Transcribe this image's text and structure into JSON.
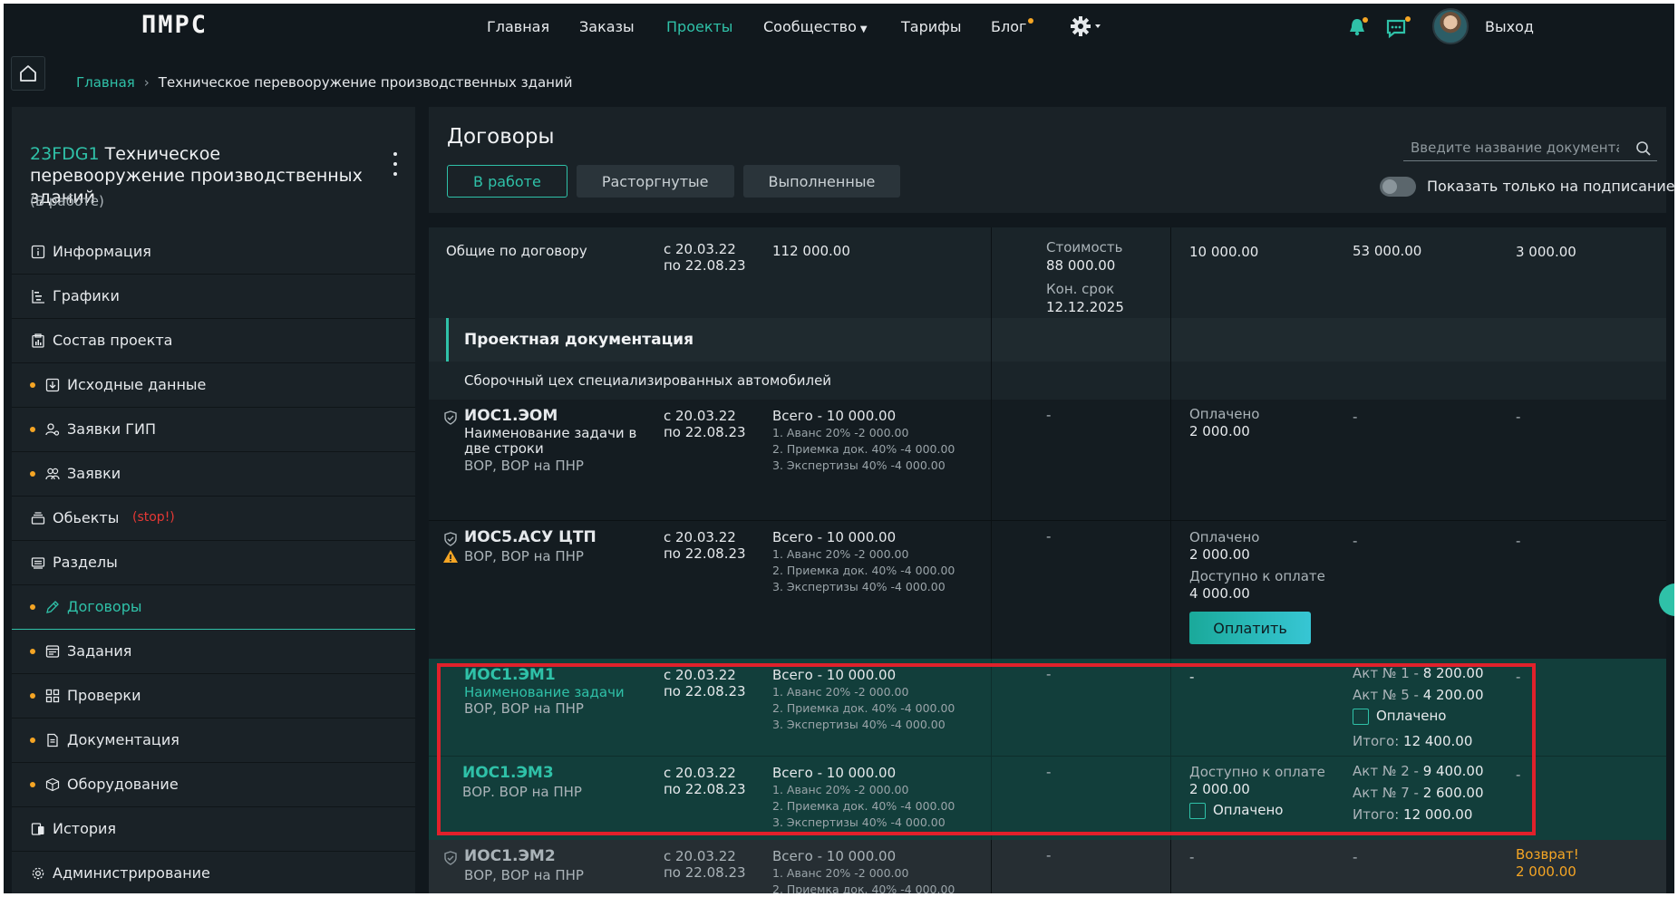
{
  "nav": {
    "logo": "ПМРС",
    "items": [
      "Главная",
      "Заказы",
      "Проекты",
      "Сообщество",
      "Тарифы",
      "Блог"
    ],
    "logout": "Выход"
  },
  "breadcrumb": {
    "home": "Главная",
    "current": "Техническое перевооружение производственных зданий"
  },
  "project": {
    "code": "23FDG1",
    "name": "Техническое перевооружение производственных зданий",
    "status": "(В работе)"
  },
  "sidebar": {
    "items": [
      {
        "label": "Информация",
        "icon": "info-icon",
        "dot": false
      },
      {
        "label": "Графики",
        "icon": "gantt-icon",
        "dot": false
      },
      {
        "label": "Состав проекта",
        "icon": "clipboard-chart-icon",
        "dot": false
      },
      {
        "label": "Исходные данные",
        "icon": "download-box-icon",
        "dot": true
      },
      {
        "label": "Заявки ГИП",
        "icon": "user-gear-icon",
        "dot": true
      },
      {
        "label": "Заявки",
        "icon": "users-icon",
        "dot": true
      },
      {
        "label": "Обьекты",
        "icon": "layers-icon",
        "dot": false,
        "badge": "(stop!)"
      },
      {
        "label": "Разделы",
        "icon": "sections-icon",
        "dot": false
      },
      {
        "label": "Договоры",
        "icon": "pen-icon",
        "dot": true,
        "active": true
      },
      {
        "label": "Задания",
        "icon": "tasks-icon",
        "dot": true
      },
      {
        "label": "Проверки",
        "icon": "grid-icon",
        "dot": true
      },
      {
        "label": "Документация",
        "icon": "document-icon",
        "dot": true
      },
      {
        "label": "Оборудование",
        "icon": "box-icon",
        "dot": true
      },
      {
        "label": "История",
        "icon": "history-icon",
        "dot": false
      },
      {
        "label": "Администрирование",
        "icon": "gear-icon",
        "dot": false
      }
    ]
  },
  "main": {
    "title": "Договоры",
    "tabs": [
      "В работе",
      "Расторгнутые",
      "Выполненные"
    ],
    "search_placeholder": "Введите название документа",
    "toggle_label": "Показать только на подписание"
  },
  "table": {
    "summary": {
      "label": "Общие по договору",
      "date_from": "с 20.03.22",
      "date_to": "по 22.08.23",
      "total": "112 000.00",
      "cost_label": "Стоимость",
      "cost": "88 000.00",
      "deadline_label": "Кон. срок",
      "deadline": "12.12.2025",
      "c5": "10 000.00",
      "c6": "53 000.00",
      "c7": "3 000.00"
    },
    "section": "Проектная документация",
    "subsection": "Сборочный цех специализированных автомобилей",
    "rows": [
      {
        "code": "ИОС1.ЭОМ",
        "name1": "Наименование задачи в",
        "name2": "две строки",
        "vor": "ВОР, ВОР на ПНР",
        "from": "с 20.03.22",
        "to": "по 22.08.23",
        "total": "Всего - 10 000.00",
        "s1": "1. Аванс 20% -2 000.00",
        "s2": "2. Приемка док. 40% -4 000.00",
        "s3": "3. Экспертизы 40% -4 000.00",
        "c4": "-",
        "paid_label": "Оплачено",
        "paid": "2 000.00",
        "c6": "-",
        "c7": "-"
      },
      {
        "code": "ИОС5.АСУ ЦТП",
        "vor": "ВОР, ВОР на ПНР",
        "from": "с 20.03.22",
        "to": "по 22.08.23",
        "total": "Всего - 10 000.00",
        "s1": "1. Аванс 20% -2 000.00",
        "s2": "2. Приемка док. 40% -4 000.00",
        "s3": "3. Экспертизы 40% -4 000.00",
        "c4": "-",
        "paid_label": "Оплачено",
        "paid": "2 000.00",
        "avail_label": "Доступно к оплате",
        "avail": "4 000.00",
        "pay_button": "Оплатить",
        "c6": "-",
        "c7": "-"
      },
      {
        "code": "ИОС1.ЭМ1",
        "name1": "Наименование задачи",
        "vor": "ВОР, ВОР на ПНР",
        "from": "с 20.03.22",
        "to": "по 22.08.23",
        "total": "Всего - 10 000.00",
        "s1": "1. Аванс 20% -2 000.00",
        "s2": "2. Приемка док. 40% -4 000.00",
        "s3": "3. Экспертизы 40% -4 000.00",
        "c4": "-",
        "c5": "-",
        "act1_label": "Акт № 1 -",
        "act1": "8 200.00",
        "act2_label": "Акт № 5 -",
        "act2": "4 200.00",
        "paid_check": "Оплачено",
        "sum_label": "Итого:",
        "sum": "12 400.00",
        "c7": "-"
      },
      {
        "code": "ИОС1.ЭМ3",
        "vor": "ВОР. ВОР на ПНР",
        "from": "с 20.03.22",
        "to": "по 22.08.23",
        "total": "Всего - 10 000.00",
        "s1": "1. Аванс 20% -2 000.00",
        "s2": "2. Приемка док. 40% -4 000.00",
        "s3": "3. Экспертизы 40% -4 000.00",
        "c4": "-",
        "avail_label": "Доступно к оплате",
        "avail": "2 000.00",
        "paid_check": "Оплачено",
        "act1_label": "Акт № 2 -",
        "act1": "9 400.00",
        "act2_label": "Акт № 7 -",
        "act2": "2 600.00",
        "sum_label": "Итого:",
        "sum": "12 000.00",
        "c7": "-"
      },
      {
        "code": "ИОС1.ЭМ2",
        "vor": "ВОР, ВОР на ПНР",
        "from": "с 20.03.22",
        "to": "по 22.08.23",
        "total": "Всего - 10 000.00",
        "s1": "1. Аванс 20% -2 000.00",
        "s2": "2. Приемка док. 40% -4 000.00",
        "c4": "-",
        "c5": "-",
        "c6": "-",
        "refund_label": "Возврат!",
        "refund": "2 000.00"
      }
    ]
  },
  "colors": {
    "accent": "#2fc1a8",
    "warning": "#f5a524",
    "danger": "#e53935",
    "highlight": "#e0212b",
    "bg": "#11181d",
    "panel": "#1a2227"
  }
}
